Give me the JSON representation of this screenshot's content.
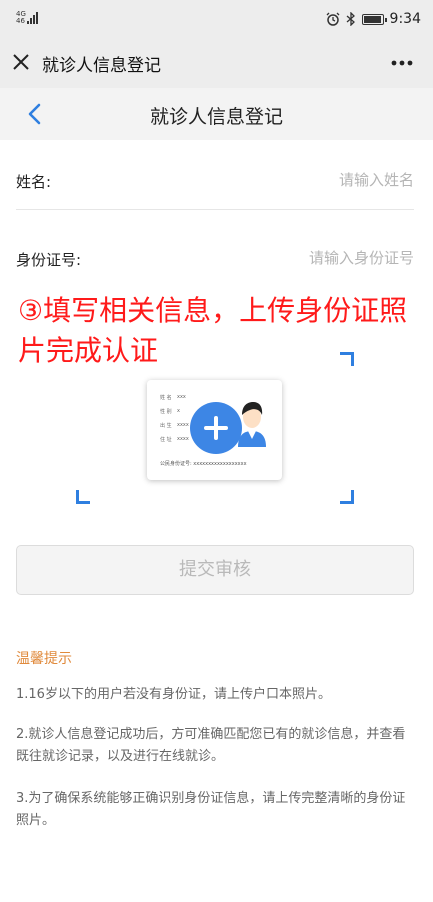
{
  "status_bar": {
    "network": "4G",
    "network_sub": "46",
    "time": "9:34"
  },
  "webview": {
    "title": "就诊人信息登记"
  },
  "header": {
    "title": "就诊人信息登记"
  },
  "form": {
    "name_label": "姓名:",
    "name_placeholder": "请输入姓名",
    "id_label": "身份证号:",
    "id_placeholder": "请输入身份证号"
  },
  "overlay": {
    "text": "③填写相关信息，上传身份证照片完成认证",
    "color": "#ff1a1a"
  },
  "id_card": {
    "field_name": "姓 名",
    "field_name_value": "xxx",
    "field_sex": "性 别",
    "field_sex_value": "x",
    "field_sex_extra": "民",
    "field_birth": "出 生",
    "field_birth_value": "xxxx",
    "field_address": "住 址",
    "field_address_value": "xxxx",
    "number_label": "公民身份证号:",
    "number_value": "xxxxxxxxxxxxxxxxxx"
  },
  "submit": {
    "label": "提交审核"
  },
  "tips": {
    "title": "温馨提示",
    "items": [
      "1.16岁以下的用户若没有身份证，请上传户口本照片。",
      "2.就诊人信息登记成功后，方可准确匹配您已有的就诊信息，并查看既往就诊记录，以及进行在线就诊。",
      "3.为了确保系统能够正确识别身份证信息，请上传完整清晰的身份证照片。"
    ]
  },
  "colors": {
    "accent": "#3d86e5",
    "tips_title": "#e08a3c"
  }
}
